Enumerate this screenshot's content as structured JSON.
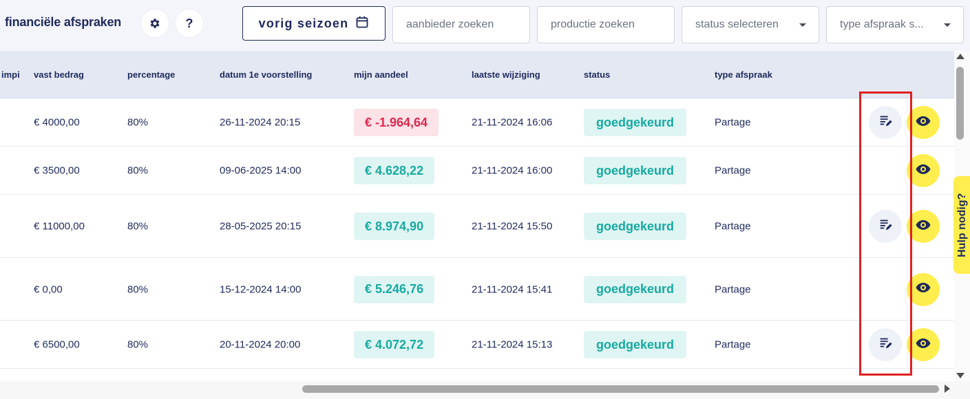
{
  "header": {
    "title": "financiële afspraken",
    "settings_icon": "gear-icon",
    "help_label": "?",
    "season_button": "vorig seizoen",
    "season_icon": "calendar-icon",
    "search_provider_placeholder": "aanbieder zoeken",
    "search_production_placeholder": "productie zoeken",
    "status_select": "status selecteren",
    "type_select": "type afspraak s..."
  },
  "table": {
    "columns": {
      "partial": "impi",
      "fixed_amount": "vast bedrag",
      "percentage": "percentage",
      "first_show": "datum 1e voorstelling",
      "my_share": "mijn aandeel",
      "last_change": "laatste wijziging",
      "status": "status",
      "type": "type afspraak"
    },
    "rows": [
      {
        "fixed_amount": "€ 4000,00",
        "percentage": "80%",
        "first_show": "26-11-2024 20:15",
        "my_share": "€ -1.964,64",
        "share_negative": true,
        "last_change": "21-11-2024 16:06",
        "status": "goedgekeurd",
        "type": "Partage",
        "has_edit": true
      },
      {
        "fixed_amount": "€ 3500,00",
        "percentage": "80%",
        "first_show": "09-06-2025 14:00",
        "my_share": "€ 4.628,22",
        "share_negative": false,
        "last_change": "21-11-2024 16:00",
        "status": "goedgekeurd",
        "type": "Partage",
        "has_edit": false
      },
      {
        "fixed_amount": "€ 11000,00",
        "percentage": "80%",
        "first_show": "28-05-2025 20:15",
        "my_share": "€ 8.974,90",
        "share_negative": false,
        "last_change": "21-11-2024 15:50",
        "status": "goedgekeurd",
        "type": "Partage",
        "has_edit": true
      },
      {
        "fixed_amount": "€ 0,00",
        "percentage": "80%",
        "first_show": "15-12-2024 14:00",
        "my_share": "€ 5.246,76",
        "share_negative": false,
        "last_change": "21-11-2024 15:41",
        "status": "goedgekeurd",
        "type": "Partage",
        "has_edit": false
      },
      {
        "fixed_amount": "€ 6500,00",
        "percentage": "80%",
        "first_show": "20-11-2024 20:00",
        "my_share": "€ 4.072,72",
        "share_negative": false,
        "last_change": "21-11-2024 15:13",
        "status": "goedgekeurd",
        "type": "Partage",
        "has_edit": true
      }
    ],
    "edit_icon": "edit-document-icon",
    "view_icon": "eye-icon"
  },
  "help_tab": "Hulp nodig?",
  "colors": {
    "navy": "#1f2a5c",
    "teal": "#17aaa0",
    "teal_bg": "#dff5f3",
    "red": "#e0284f",
    "red_bg": "#fbe3e8",
    "yellow": "#ffee4d",
    "highlight": "#e02020"
  }
}
